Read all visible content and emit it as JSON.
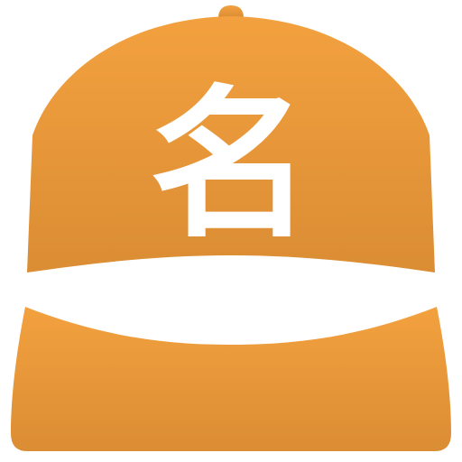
{
  "icon": {
    "name": "baseball-cap-icon",
    "character": "名",
    "colors": {
      "top": "#F3A13F",
      "bottom": "#DB8D34",
      "band": "#FFFFFF",
      "character": "#FFFFFF"
    }
  }
}
